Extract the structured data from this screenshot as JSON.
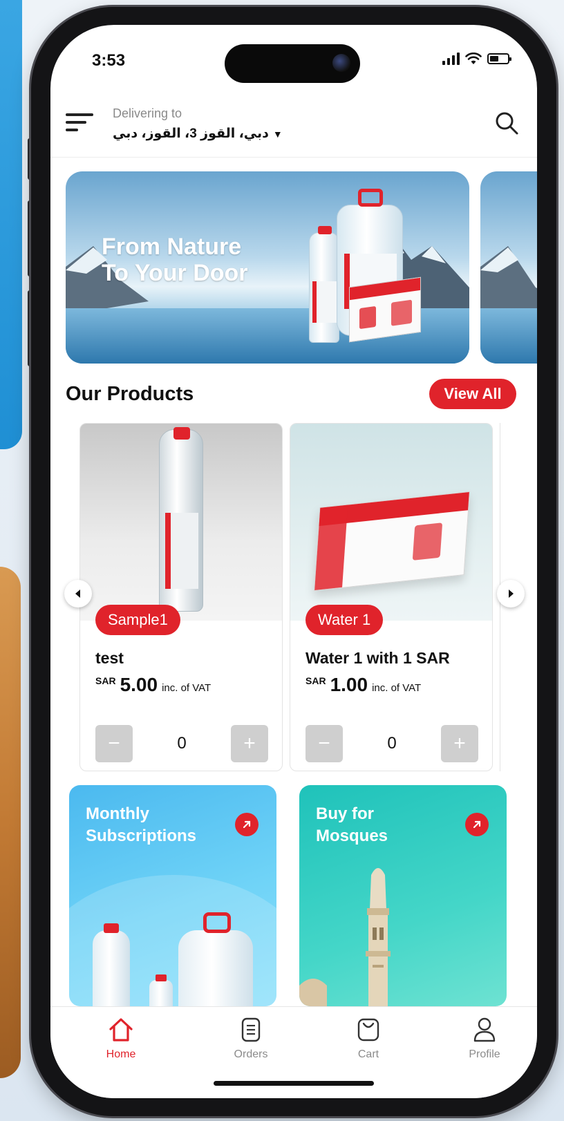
{
  "status_bar": {
    "time": "3:53"
  },
  "header": {
    "delivering_label": "Delivering to",
    "address": "دبي، القوز 3، القوز، دبي"
  },
  "banner": {
    "title_line1": "From Nature",
    "title_line2": "To Your Door"
  },
  "products_section": {
    "title": "Our Products",
    "view_all_label": "View All",
    "products": [
      {
        "tag": "Sample1",
        "name": "test",
        "currency": "SAR",
        "price": "5.00",
        "vat_note": "inc. of VAT",
        "quantity": "0"
      },
      {
        "tag": "Water 1",
        "name": "Water 1 with 1 SAR",
        "currency": "SAR",
        "price": "1.00",
        "vat_note": "inc. of VAT",
        "quantity": "0"
      }
    ]
  },
  "promos": [
    {
      "title_line1": "Monthly",
      "title_line2": "Subscriptions"
    },
    {
      "title_line1": "Buy for",
      "title_line2": "Mosques"
    }
  ],
  "bottom_nav": {
    "items": [
      {
        "label": "Home",
        "icon": "home-icon"
      },
      {
        "label": "Orders",
        "icon": "orders-icon"
      },
      {
        "label": "Cart",
        "icon": "cart-icon"
      },
      {
        "label": "Profile",
        "icon": "profile-icon"
      }
    ],
    "active": "Home"
  },
  "colors": {
    "accent": "#e0232b",
    "text": "#111111",
    "muted": "#8a8a8a"
  }
}
